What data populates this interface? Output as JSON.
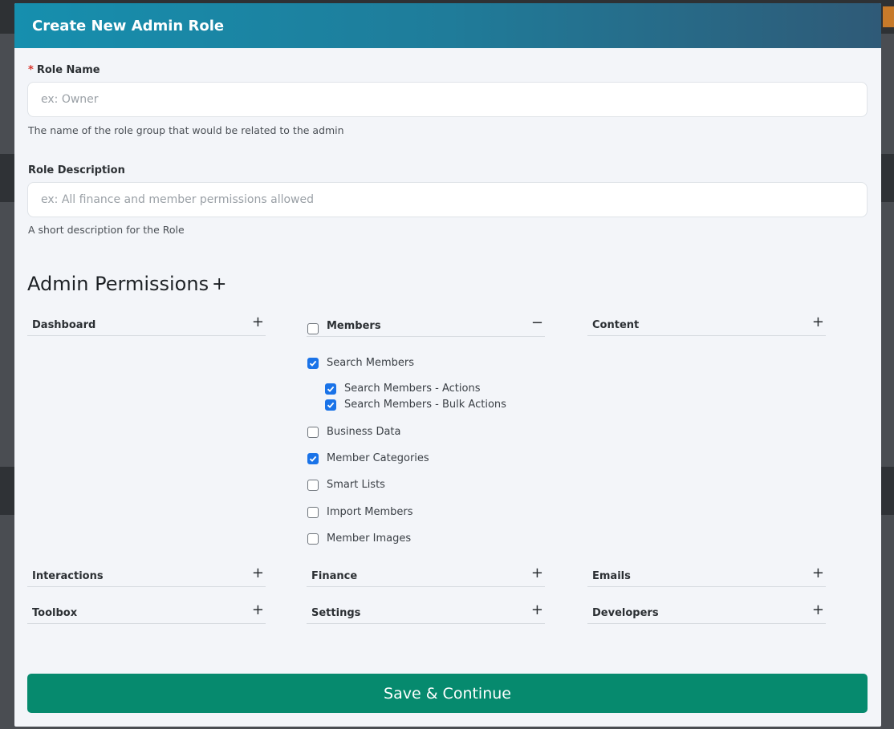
{
  "modal": {
    "title": "Create New Admin Role"
  },
  "role_name": {
    "label": "Role Name",
    "required_marker": "*",
    "placeholder": "ex: Owner",
    "value": "",
    "hint": "The name of the role group that would be related to the admin"
  },
  "role_description": {
    "label": "Role Description",
    "placeholder": "ex: All finance and member permissions allowed",
    "value": "",
    "hint": "A short description for the Role"
  },
  "permissions": {
    "title": "Admin Permissions",
    "add_symbol": "+",
    "sections": {
      "dashboard": {
        "label": "Dashboard",
        "toggle": "+"
      },
      "members": {
        "label": "Members",
        "toggle": "−",
        "checked": false,
        "items": [
          {
            "label": "Search Members",
            "checked": true
          },
          {
            "label": "Search Members - Actions",
            "checked": true
          },
          {
            "label": "Search Members - Bulk Actions",
            "checked": true
          },
          {
            "label": "Business Data",
            "checked": false
          },
          {
            "label": "Member Categories",
            "checked": true
          },
          {
            "label": "Smart Lists",
            "checked": false
          },
          {
            "label": "Import Members",
            "checked": false
          },
          {
            "label": "Member Images",
            "checked": false
          }
        ]
      },
      "content": {
        "label": "Content",
        "toggle": "+"
      },
      "interactions": {
        "label": "Interactions",
        "toggle": "+"
      },
      "finance": {
        "label": "Finance",
        "toggle": "+"
      },
      "emails": {
        "label": "Emails",
        "toggle": "+"
      },
      "toolbox": {
        "label": "Toolbox",
        "toggle": "+"
      },
      "settings": {
        "label": "Settings",
        "toggle": "+"
      },
      "developers": {
        "label": "Developers",
        "toggle": "+"
      }
    }
  },
  "actions": {
    "save_label": "Save & Continue"
  },
  "colors": {
    "header_start": "#168fae",
    "header_end": "#2f5a77",
    "save_button": "#068a6e",
    "checkbox_checked": "#1a73e8",
    "required": "#d9342b"
  }
}
